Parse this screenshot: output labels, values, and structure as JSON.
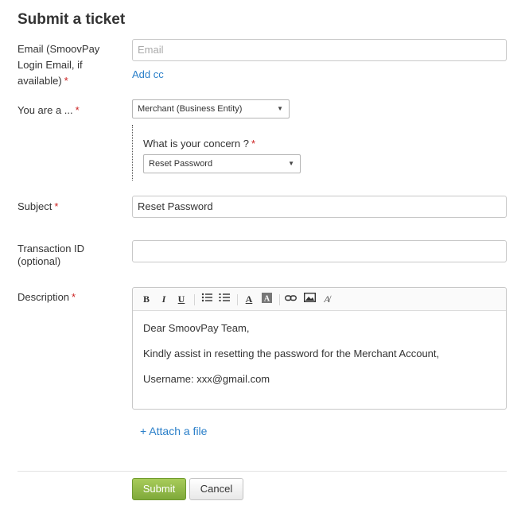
{
  "page_title": "Submit a ticket",
  "email": {
    "label": "Email (SmoovPay Login Email, if available)",
    "placeholder": "Email",
    "add_cc": "Add cc"
  },
  "you_are": {
    "label": "You are a ...",
    "selected": "Merchant (Business Entity)"
  },
  "concern": {
    "label": "What is your concern ?",
    "selected": "Reset Password"
  },
  "subject": {
    "label": "Subject",
    "value": "Reset Password"
  },
  "transaction": {
    "label": "Transaction ID (optional)",
    "value": ""
  },
  "description": {
    "label": "Description",
    "toolbar": [
      "bold-icon",
      "italic-icon",
      "underline-icon",
      "bulleted-list-icon",
      "numbered-list-icon",
      "font-color-icon",
      "background-color-icon",
      "link-icon",
      "image-icon",
      "clear-format-icon"
    ],
    "lines": [
      "Dear SmoovPay Team,",
      "Kindly assist in resetting the password for the Merchant Account,",
      "Username: xxx@gmail.com"
    ]
  },
  "attach": "+ Attach a file",
  "buttons": {
    "submit": "Submit",
    "cancel": "Cancel"
  },
  "required_marker": "*",
  "colors": {
    "link": "#2a7fc9",
    "required": "#cc2222",
    "submit_bg": "#8fb847"
  }
}
